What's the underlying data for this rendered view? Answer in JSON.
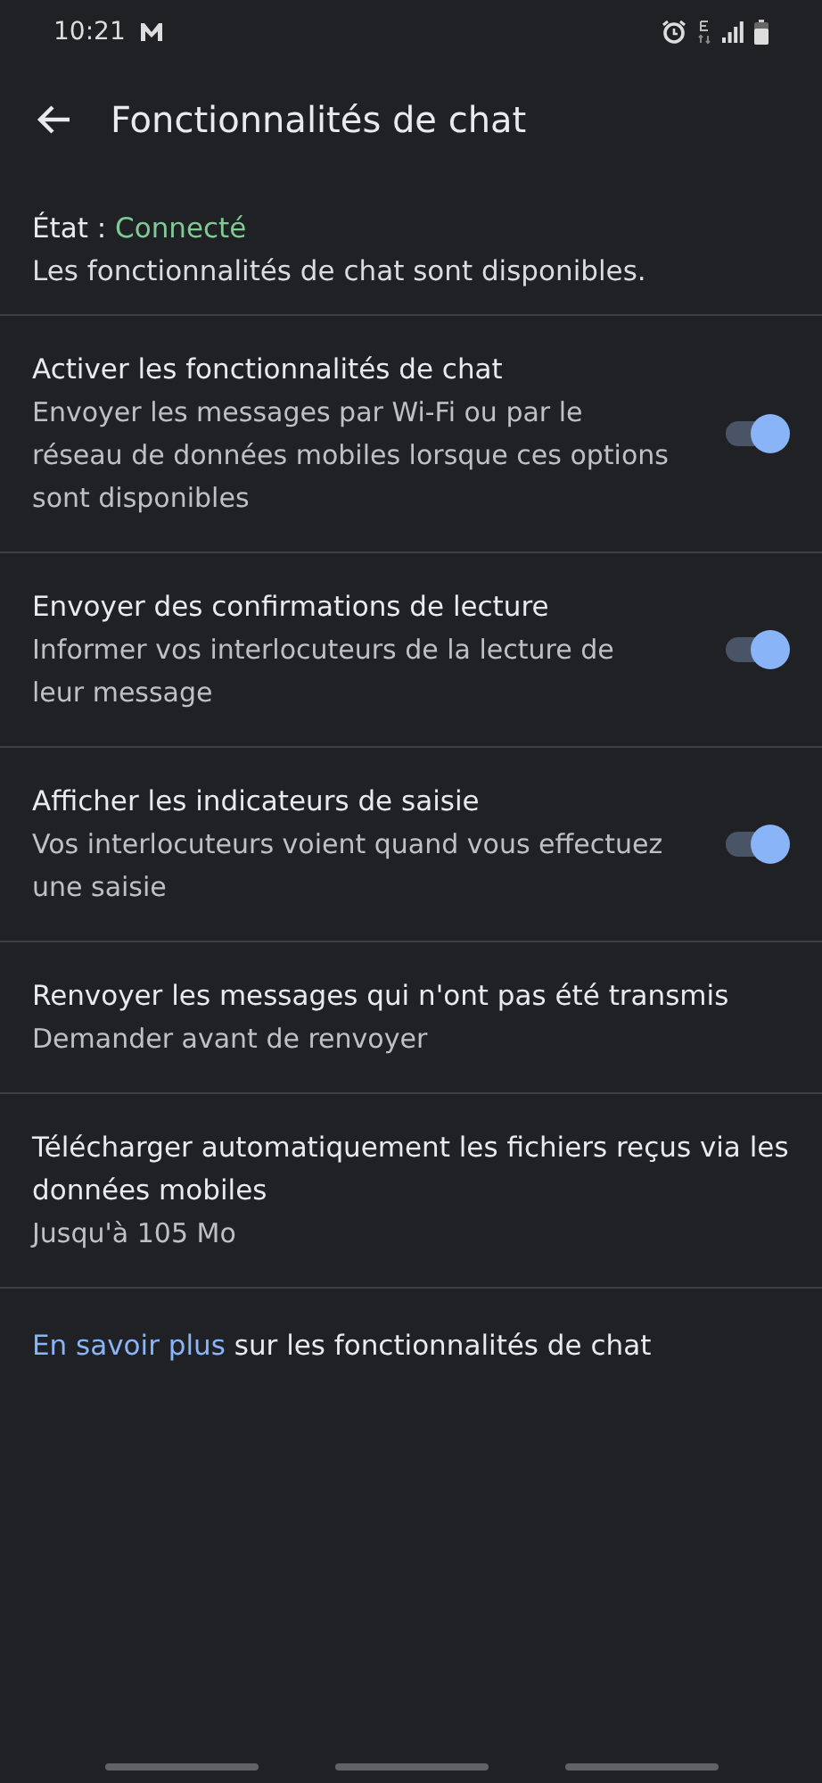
{
  "status_bar": {
    "time": "10:21"
  },
  "header": {
    "title": "Fonctionnalités de chat"
  },
  "status": {
    "label": "État :",
    "value": "Connecté",
    "description": "Les fonctionnalités de chat sont disponibles."
  },
  "settings": [
    {
      "kind": "toggle",
      "title": "Activer les fonctionnalités de chat",
      "subtitle": "Envoyer les messages par Wi-Fi ou par le réseau de données mobiles lorsque ces options sont disponibles",
      "on": true
    },
    {
      "kind": "toggle",
      "title": "Envoyer des confirmations de lecture",
      "subtitle": "Informer vos interlocuteurs de la lecture de leur message",
      "on": true
    },
    {
      "kind": "toggle",
      "title": "Afficher les indicateurs de saisie",
      "subtitle": "Vos interlocuteurs voient quand vous effectuez une saisie",
      "on": true
    },
    {
      "kind": "text",
      "title": "Renvoyer les messages qui n'ont pas été transmis",
      "subtitle": "Demander avant de renvoyer"
    },
    {
      "kind": "text",
      "title": "Télécharger automatiquement les fichiers reçus via les données mobiles",
      "subtitle": "Jusqu'à 105 Mo"
    }
  ],
  "footer": {
    "link": "En savoir plus",
    "text": " sur les fonctionnalités de chat"
  }
}
